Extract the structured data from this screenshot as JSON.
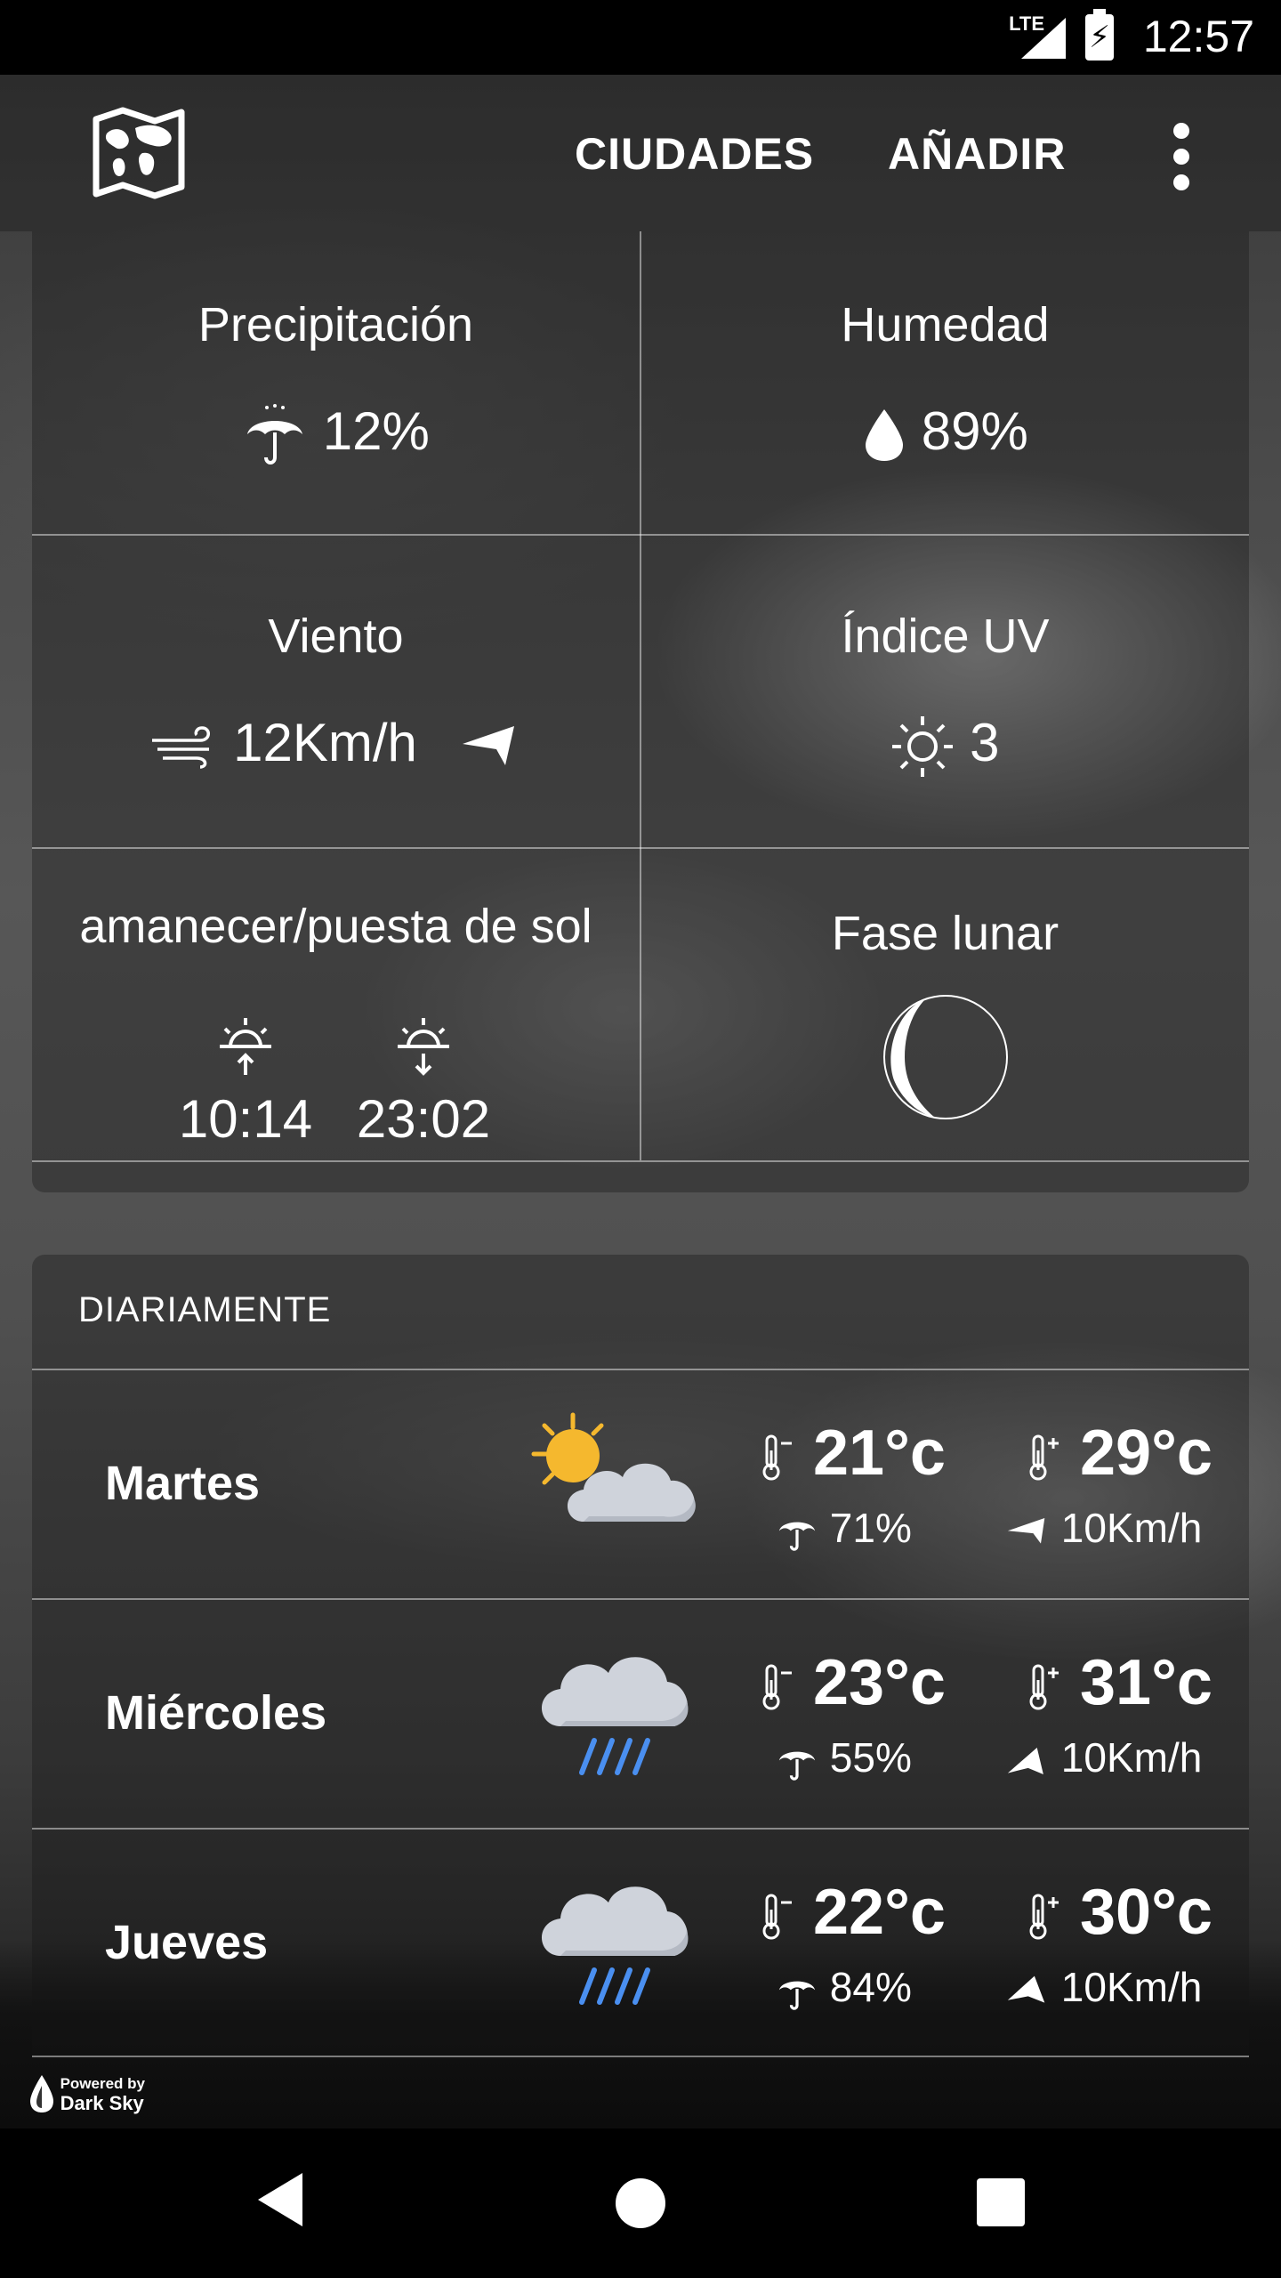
{
  "status_bar": {
    "network": "LTE",
    "time": "12:57"
  },
  "app_bar": {
    "cities_label": "CIUDADES",
    "add_label": "AÑADIR"
  },
  "details": {
    "precipitation": {
      "title": "Precipitación",
      "value": "12%"
    },
    "humidity": {
      "title": "Humedad",
      "value": "89%"
    },
    "wind": {
      "title": "Viento",
      "value": "12Km/h"
    },
    "uv": {
      "title": "Índice UV",
      "value": "3"
    },
    "sun": {
      "title": "amanecer/puesta de sol",
      "sunrise": "10:14",
      "sunset": "23:02"
    },
    "moon": {
      "title": "Fase lunar"
    }
  },
  "daily": {
    "header": "DIARIAMENTE",
    "rows": [
      {
        "day": "Martes",
        "icon": "partly-cloudy-day-icon",
        "min": "21°c",
        "max": "29°c",
        "precip": "71%",
        "wind": "10Km/h"
      },
      {
        "day": "Miércoles",
        "icon": "rain-icon",
        "min": "23°c",
        "max": "31°c",
        "precip": "55%",
        "wind": "10Km/h"
      },
      {
        "day": "Jueves",
        "icon": "rain-icon",
        "min": "22°c",
        "max": "30°c",
        "precip": "84%",
        "wind": "10Km/h"
      }
    ]
  },
  "powered_by": {
    "line1": "Powered by",
    "line2": "Dark Sky"
  },
  "colors": {
    "rain_blue": "#4a8ff0",
    "sun_yellow": "#f5b82e",
    "cloud": "#cfd3db"
  }
}
